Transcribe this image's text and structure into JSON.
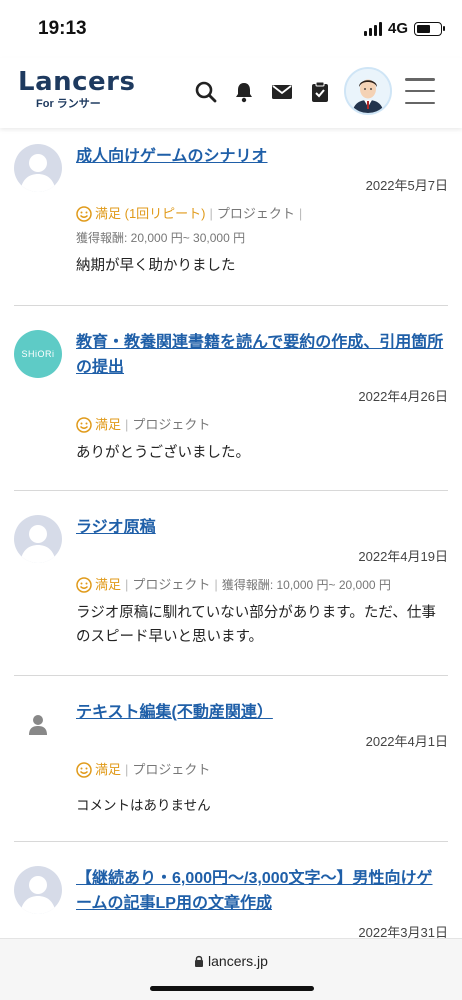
{
  "status": {
    "time": "19:13",
    "network": "4G"
  },
  "header": {
    "logo": "Lancers",
    "logo_sub": "For ランサー"
  },
  "items": [
    {
      "title": "成人向けゲームのシナリオ",
      "date": "2022年5月7日",
      "satisfaction": "満足 (1回リピート)",
      "type": "プロジェクト",
      "reward": "獲得報酬: 20,000 円~ 30,000 円",
      "comment": "納期が早く助かりました"
    },
    {
      "title": "教育・教養関連書籍を読んで要約の作成、引用箇所の提出",
      "avatar_text": "SHiORi",
      "date": "2022年4月26日",
      "satisfaction": "満足",
      "type": "プロジェクト",
      "comment": "ありがとうございました。"
    },
    {
      "title": "ラジオ原稿",
      "date": "2022年4月19日",
      "satisfaction": "満足",
      "type": "プロジェクト",
      "reward": "獲得報酬: 10,000 円~ 20,000 円",
      "comment": "ラジオ原稿に馴れていない部分があります。ただ、仕事のスピード早いと思います。"
    },
    {
      "title": "テキスト編集(不動産関連）",
      "date": "2022年4月1日",
      "satisfaction": "満足",
      "type": "プロジェクト",
      "comment": "コメントはありません"
    },
    {
      "title": "【継続あり・6,000円〜/3,000文字〜】男性向けゲームの記事LP用の文章作成",
      "date": "2022年3月31日"
    }
  ],
  "browser": {
    "url": "lancers.jp"
  },
  "colors": {
    "link": "#1f5fa8",
    "satisfied": "#e09a1a",
    "brand": "#1e3a5f",
    "shiori": "#5ecbc6"
  }
}
